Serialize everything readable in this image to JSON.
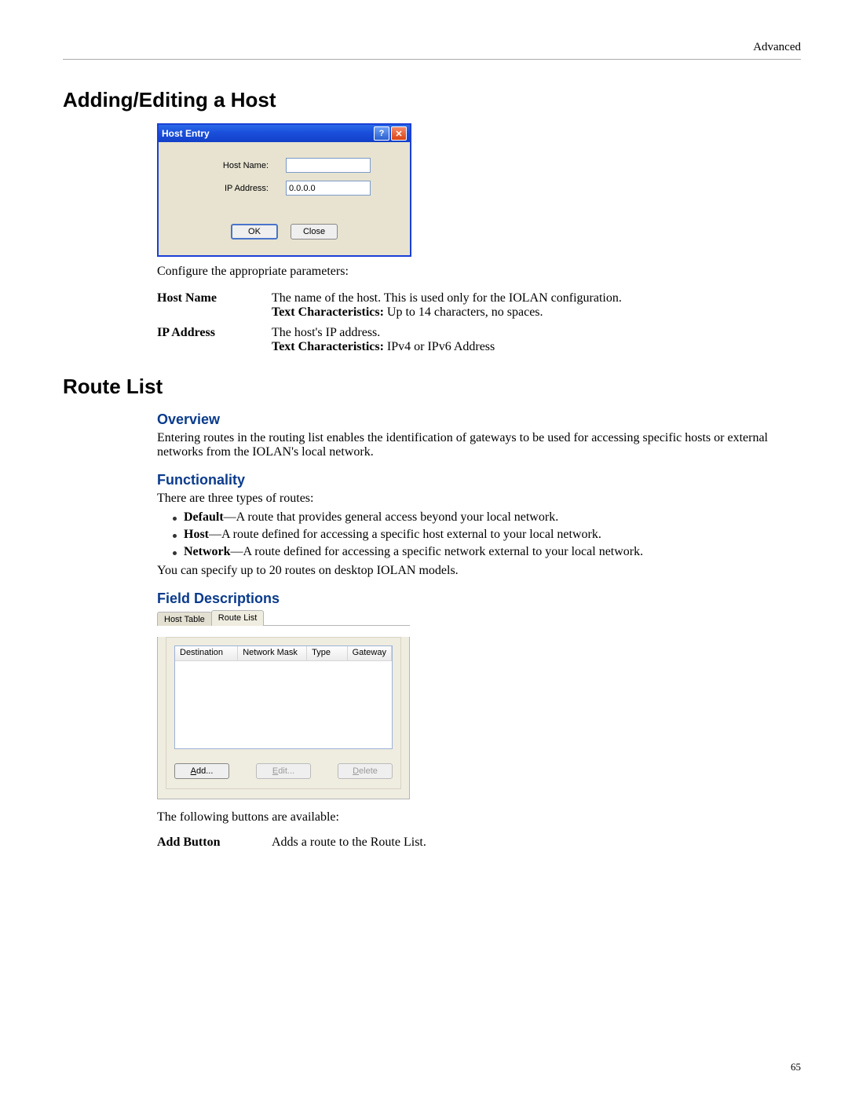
{
  "header": {
    "right": "Advanced"
  },
  "section1": {
    "title": "Adding/Editing a Host"
  },
  "dialog": {
    "title": "Host Entry",
    "hostname_label": "Host Name:",
    "hostname_value": "",
    "ipaddr_label": "IP Address:",
    "ipaddr_value": "0.0.0.0",
    "ok": "OK",
    "close": "Close"
  },
  "config_intro": "Configure the appropriate parameters:",
  "params": {
    "hostname_key": "Host Name",
    "hostname_desc": "The name of the host. This is used only for the IOLAN configuration.",
    "hostname_textchar_label": "Text Characteristics:",
    "hostname_textchar": " Up to 14 characters, no spaces.",
    "ipaddr_key": "IP Address",
    "ipaddr_desc": "The host's IP address.",
    "ipaddr_textchar_label": "Text Characteristics:",
    "ipaddr_textchar": " IPv4 or IPv6 Address"
  },
  "section2": {
    "title": "Route List"
  },
  "overview": {
    "heading": "Overview",
    "text": "Entering routes in the routing list enables the identification of gateways to be used for accessing specific hosts or external networks from the IOLAN's local network."
  },
  "functionality": {
    "heading": "Functionality",
    "intro": "There are three types of routes:",
    "b1_term": "Default",
    "b1_rest": "—A route that provides general access beyond your local network.",
    "b2_term": "Host",
    "b2_rest": "—A route defined for accessing a specific host external to your local network.",
    "b3_term": "Network",
    "b3_rest": "—A route defined for accessing a specific network external to your local network.",
    "note": "You can specify up to 20 routes on desktop IOLAN models."
  },
  "fielddesc": {
    "heading": "Field Descriptions"
  },
  "route_panel": {
    "tab1": "Host Table",
    "tab2": "Route List",
    "col1": "Destination",
    "col2": "Network Mask",
    "col3": "Type",
    "col4": "Gateway",
    "add_u": "A",
    "add_rest": "dd...",
    "edit_u": "E",
    "edit_rest": "dit...",
    "delete_u": "D",
    "delete_rest": "elete"
  },
  "buttons_intro": "The following buttons are available:",
  "addbtn_key": "Add Button",
  "addbtn_desc": "Adds a route to the Route List.",
  "page_number": "65"
}
